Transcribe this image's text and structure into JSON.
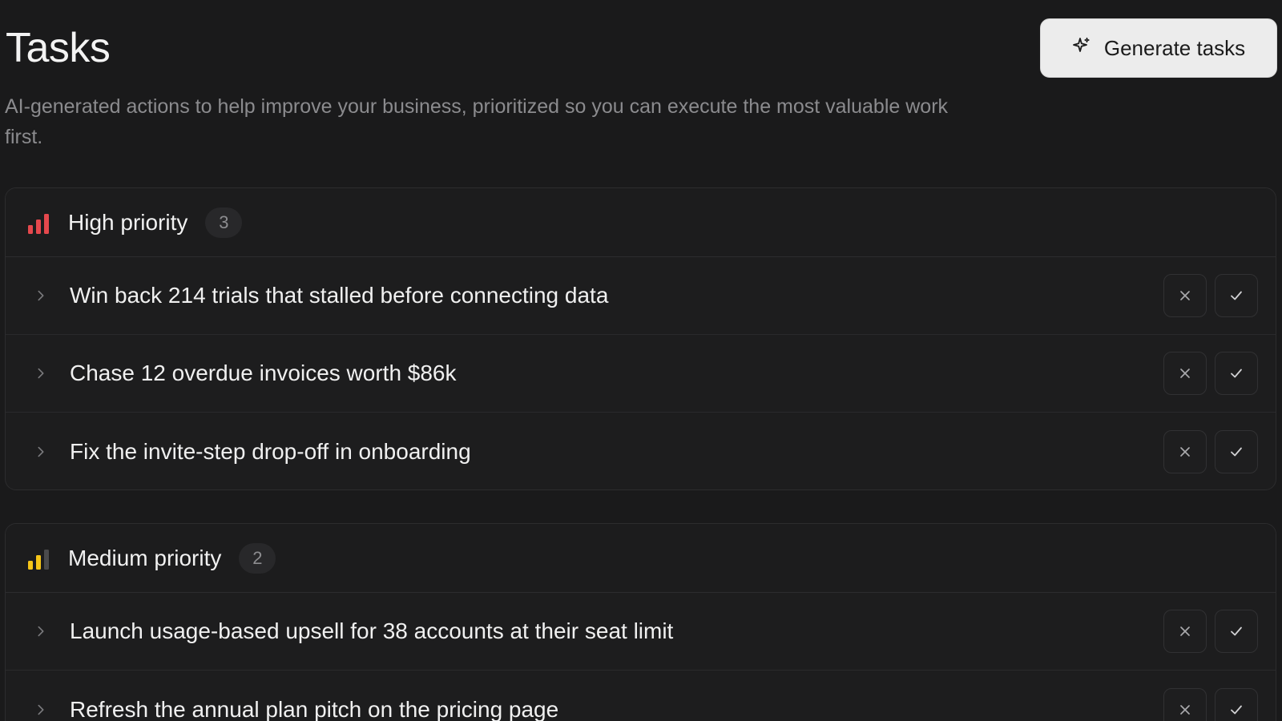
{
  "header": {
    "title": "Tasks",
    "description": "AI-generated actions to help improve your business, prioritized so you can execute the most valuable work first.",
    "generate_button": {
      "label": "Generate tasks",
      "icon": "sparkle-icon"
    }
  },
  "groups": [
    {
      "label": "High priority",
      "count": "3",
      "icon": "signal-bars-high-icon",
      "color": "#e5484d",
      "tasks": [
        {
          "title": "Win back 214 trials that stalled before connecting data"
        },
        {
          "title": "Chase 12 overdue invoices worth $86k"
        },
        {
          "title": "Fix the invite-step drop-off in onboarding"
        }
      ]
    },
    {
      "label": "Medium priority",
      "count": "2",
      "icon": "signal-bars-medium-icon",
      "color": "#f5c518",
      "tasks": [
        {
          "title": "Launch usage-based upsell for 38 accounts at their seat limit"
        },
        {
          "title": "Refresh the annual plan pitch on the pricing page"
        }
      ]
    }
  ],
  "row_actions": {
    "dismiss_icon": "close-icon",
    "accept_icon": "check-icon"
  },
  "colors": {
    "background": "#1a1a1b",
    "muted_bar": "#4a4a4c"
  }
}
